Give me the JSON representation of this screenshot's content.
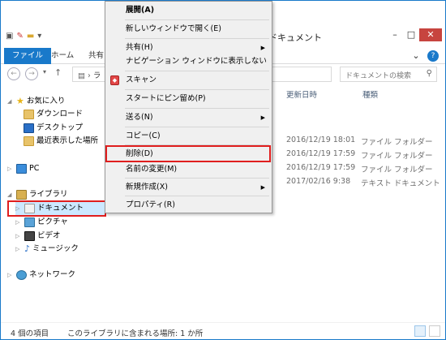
{
  "window": {
    "title": "ドキュメント"
  },
  "ribbon": {
    "tabs": [
      "ファイル",
      "ホーム",
      "共有"
    ],
    "help": "?"
  },
  "address": {
    "path": "ラ",
    "search_placeholder": "ドキュメントの検索"
  },
  "nav": {
    "favorites": "お気に入り",
    "downloads": "ダウンロード",
    "desktop": "デスクトップ",
    "recent": "最近表示した場所",
    "pc": "PC",
    "libraries": "ライブラリ",
    "documents": "ドキュメント",
    "pictures": "ピクチャ",
    "videos": "ビデオ",
    "music": "ミュージック",
    "network": "ネットワーク"
  },
  "columns": {
    "date": "更新日時",
    "type": "種類"
  },
  "rows": [
    {
      "date": "2016/12/19 18:01",
      "type": "ファイル フォルダー"
    },
    {
      "date": "2016/12/19 17:59",
      "type": "ファイル フォルダー"
    },
    {
      "date": "2016/12/19 17:59",
      "type": "ファイル フォルダー"
    },
    {
      "date": "2017/02/16 9:38",
      "type": "テキスト ドキュメント"
    }
  ],
  "status": {
    "count": "4 個の項目",
    "location": "このライブラリに含まれる場所: 1 か所"
  },
  "context_menu": {
    "expand": "展開(A)",
    "open_new_window": "新しいウィンドウで開く(E)",
    "share": "共有(H)",
    "show_in_nav": "ナビゲーション ウィンドウに表示しない",
    "scan": "スキャン",
    "pin_start": "スタートにピン留め(P)",
    "send_to": "送る(N)",
    "copy": "コピー(C)",
    "delete": "削除(D)",
    "rename": "名前の変更(M)",
    "new": "新規作成(X)",
    "properties": "プロパティ(R)"
  },
  "colors": {
    "accent": "#1979ca",
    "highlight_box": "#e01e1e",
    "selection": "#cce8ff"
  }
}
